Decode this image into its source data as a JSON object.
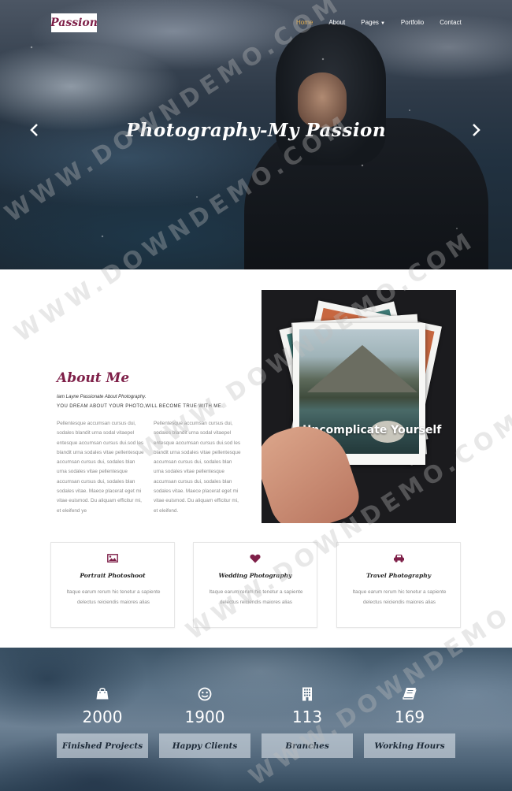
{
  "header": {
    "logo": "Passion",
    "nav": [
      {
        "label": "Home",
        "active": true
      },
      {
        "label": "About",
        "active": false
      },
      {
        "label": "Pages",
        "active": false,
        "has_dropdown": true
      },
      {
        "label": "Portfolio",
        "active": false
      },
      {
        "label": "Contact",
        "active": false
      }
    ]
  },
  "hero": {
    "title": "Photography-My Passion",
    "prev_icon": "chevron-left-icon",
    "next_icon": "chevron-right-icon"
  },
  "about": {
    "title": "About Me",
    "subtitle1": "Iam Layne Passionate About Photography.",
    "subtitle2": "YOU DREAM ABOUT YOUR PHOTO,WILL BECOME TRUE WITH ME.",
    "col1": "Pellentesque accumsan cursus dui, sodales blandit urna sodal vitaepel entesque accumsan cursus dui.sod les blandit urna sodales vitae pellentesque accumsan cursus dui, sodales blan urna sodales vitae pellentesque accumsan cursus dui, sodales blan sodales vitae. Maece placerat eget mi vitae euismod. Du aliquam efficitur mi, et eleifend ye",
    "col2": "Pellentesque accumsan cursus dui, sodales blandit urna sodal vitaepel entesque accumsan cursus dui.sod les blandit urna sodales vitae pellentesque accumsan cursus dui, sodales blan urna sodales vitae pellentesque accumsan cursus dui, sodales blan sodales vitae. Maece placerat eget mi vitae euismod. Du aliquam efficitur mi, et eleifend.",
    "image_text": "Uncomplicate Yourself"
  },
  "services": [
    {
      "icon": "image-icon",
      "title": "Portrait Photoshoot",
      "text": "Itaque earum rerum hic tenetur a sapiente delectus reiciendis maiores alias"
    },
    {
      "icon": "heart-icon",
      "title": "Wedding Photography",
      "text": "Itaque earum rerum hic tenetur a sapiente delectus reiciendis maiores alias"
    },
    {
      "icon": "car-icon",
      "title": "Travel Photography",
      "text": "Itaque earum rerum hic tenetur a sapiente delectus reiciendis maiores alias"
    }
  ],
  "stats": [
    {
      "icon": "shopping-bag-icon",
      "value": "2000",
      "label": "Finished Projects"
    },
    {
      "icon": "smiley-icon",
      "value": "1900",
      "label": "Happy Clients"
    },
    {
      "icon": "building-icon",
      "value": "113",
      "label": "Branches"
    },
    {
      "icon": "book-icon",
      "value": "169",
      "label": "Working Hours"
    }
  ],
  "watermark": "WWW.DOWNDEMO.COM",
  "colors": {
    "brand": "#7e1f48",
    "nav_active": "#e8b04c",
    "text_muted": "#8a8a8a"
  }
}
